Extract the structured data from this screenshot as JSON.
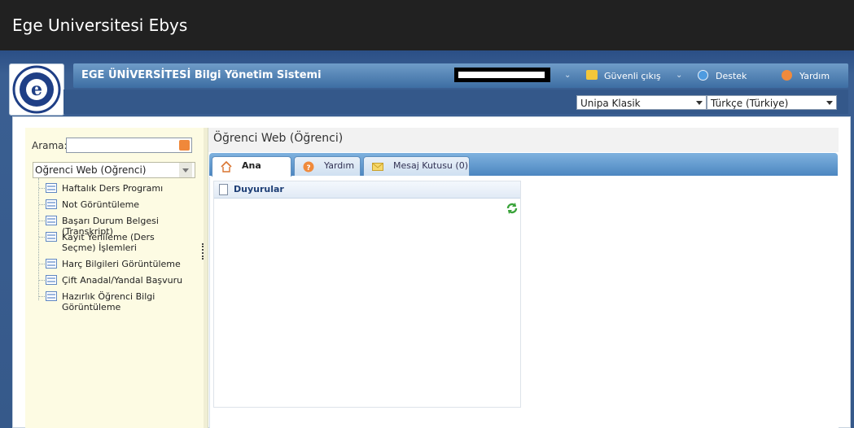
{
  "app_title": "Ege Universitesi Ebys",
  "header": {
    "system_name": "EGE ÜNİVERSİTESİ Bilgi Yönetim Sistemi",
    "links": {
      "logout": "Güvenli çıkış",
      "support": "Destek",
      "help": "Yardım"
    }
  },
  "selects": {
    "theme": "Unipa Klasik",
    "language": "Türkçe (Türkiye)"
  },
  "sidebar": {
    "search_label": "Arama:",
    "search_value": "",
    "menu_select": "Oğrenci Web (Oğrenci)",
    "items": [
      {
        "label": "Haftalık Ders Programı"
      },
      {
        "label": "Not Görüntüleme"
      },
      {
        "label": "Başarı Durum Belgesi (Transkript)"
      },
      {
        "label": "Kayıt Yenileme (Ders Seçme) İşlemleri"
      },
      {
        "label": "Harç Bilgileri Görüntüleme"
      },
      {
        "label": "Çift Anadal/Yandal Başvuru"
      },
      {
        "label": "Hazırlık Öğrenci Bilgi Görüntüleme"
      }
    ]
  },
  "main": {
    "page_title": "Öğrenci Web (Öğrenci)",
    "tabs": [
      {
        "label": "Ana Sayfa"
      },
      {
        "label": "Yardım"
      },
      {
        "label": "Mesaj Kutusu (0)"
      }
    ],
    "announcements_title": "Duyurular"
  },
  "colors": {
    "app_bar": "#212121",
    "header_blue": "#3d6ea3",
    "sidebar_bg": "#fdfbe3"
  }
}
